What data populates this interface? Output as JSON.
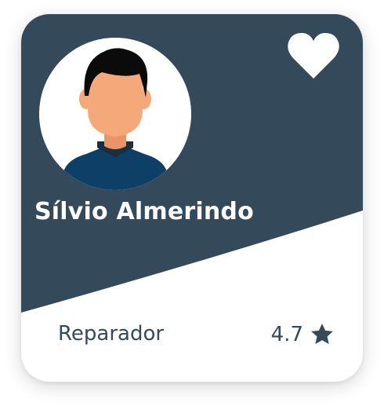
{
  "colors": {
    "header": "#34495a",
    "text_dark": "#34495a",
    "card": "#ffffff",
    "avatar_shirt": "#0e3f66",
    "avatar_skin": "#f5a97a"
  },
  "profile": {
    "name": "Sílvio Almerindo",
    "role": "Reparador",
    "rating": "4.7",
    "favorite_icon": "heart-icon",
    "rating_icon": "star-icon",
    "avatar_icon": "person-avatar"
  }
}
